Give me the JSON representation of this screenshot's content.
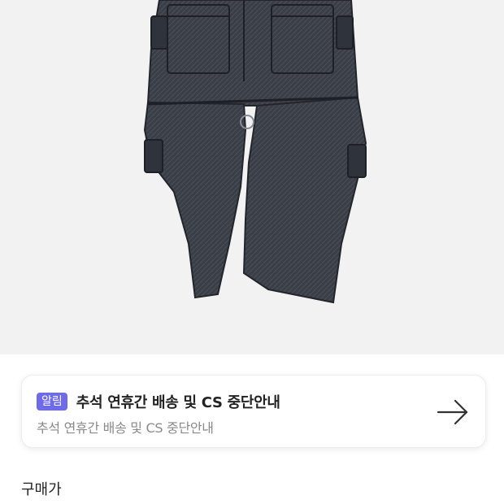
{
  "product": {
    "image_alt": "dark denim cargo pants"
  },
  "notice": {
    "badge": "알림",
    "title": "추석 연휴간 배송 및 CS 중단안내",
    "subtitle": "추석 연휴간 배송 및 CS 중단안내",
    "arrow_icon": "arrow-right-icon"
  },
  "price": {
    "label": "구매가"
  },
  "colors": {
    "image_bg": "#f2f2f2",
    "badge_bg": "#6d6af0",
    "title_text": "#222222",
    "subtitle_text": "#8a8a8a"
  }
}
